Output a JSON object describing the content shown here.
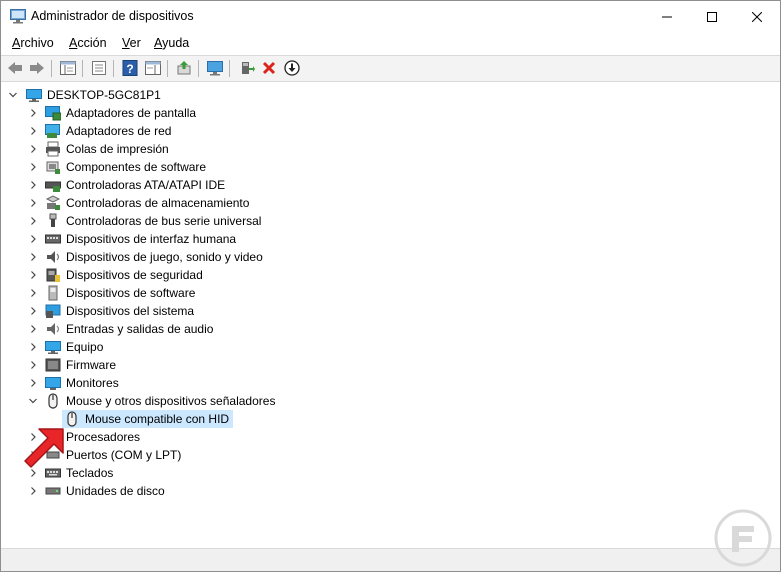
{
  "window": {
    "title": "Administrador de dispositivos"
  },
  "menu": [
    {
      "underline": "A",
      "rest": "rchivo"
    },
    {
      "underline": "A",
      "rest": "cción"
    },
    {
      "underline": "V",
      "rest": "er"
    },
    {
      "underline": "A",
      "rest": "yuda"
    }
  ],
  "tree": {
    "root": "DESKTOP-5GC81P1",
    "categories": [
      "Adaptadores de pantalla",
      "Adaptadores de red",
      "Colas de impresión",
      "Componentes de software",
      "Controladoras ATA/ATAPI IDE",
      "Controladoras de almacenamiento",
      "Controladoras de bus serie universal",
      "Dispositivos de interfaz humana",
      "Dispositivos de juego, sonido y video",
      "Dispositivos de seguridad",
      "Dispositivos de software",
      "Dispositivos del sistema",
      "Entradas y salidas de audio",
      "Equipo",
      "Firmware",
      "Monitores",
      "Mouse y otros dispositivos señaladores"
    ],
    "expanded_child": "Mouse compatible con HID",
    "categories_after": [
      "Procesadores",
      "Puertos (COM y LPT)",
      "Teclados",
      "Unidades de disco"
    ]
  },
  "colors": {
    "selection": "#cce8ff",
    "arrow": "#e8262a"
  }
}
